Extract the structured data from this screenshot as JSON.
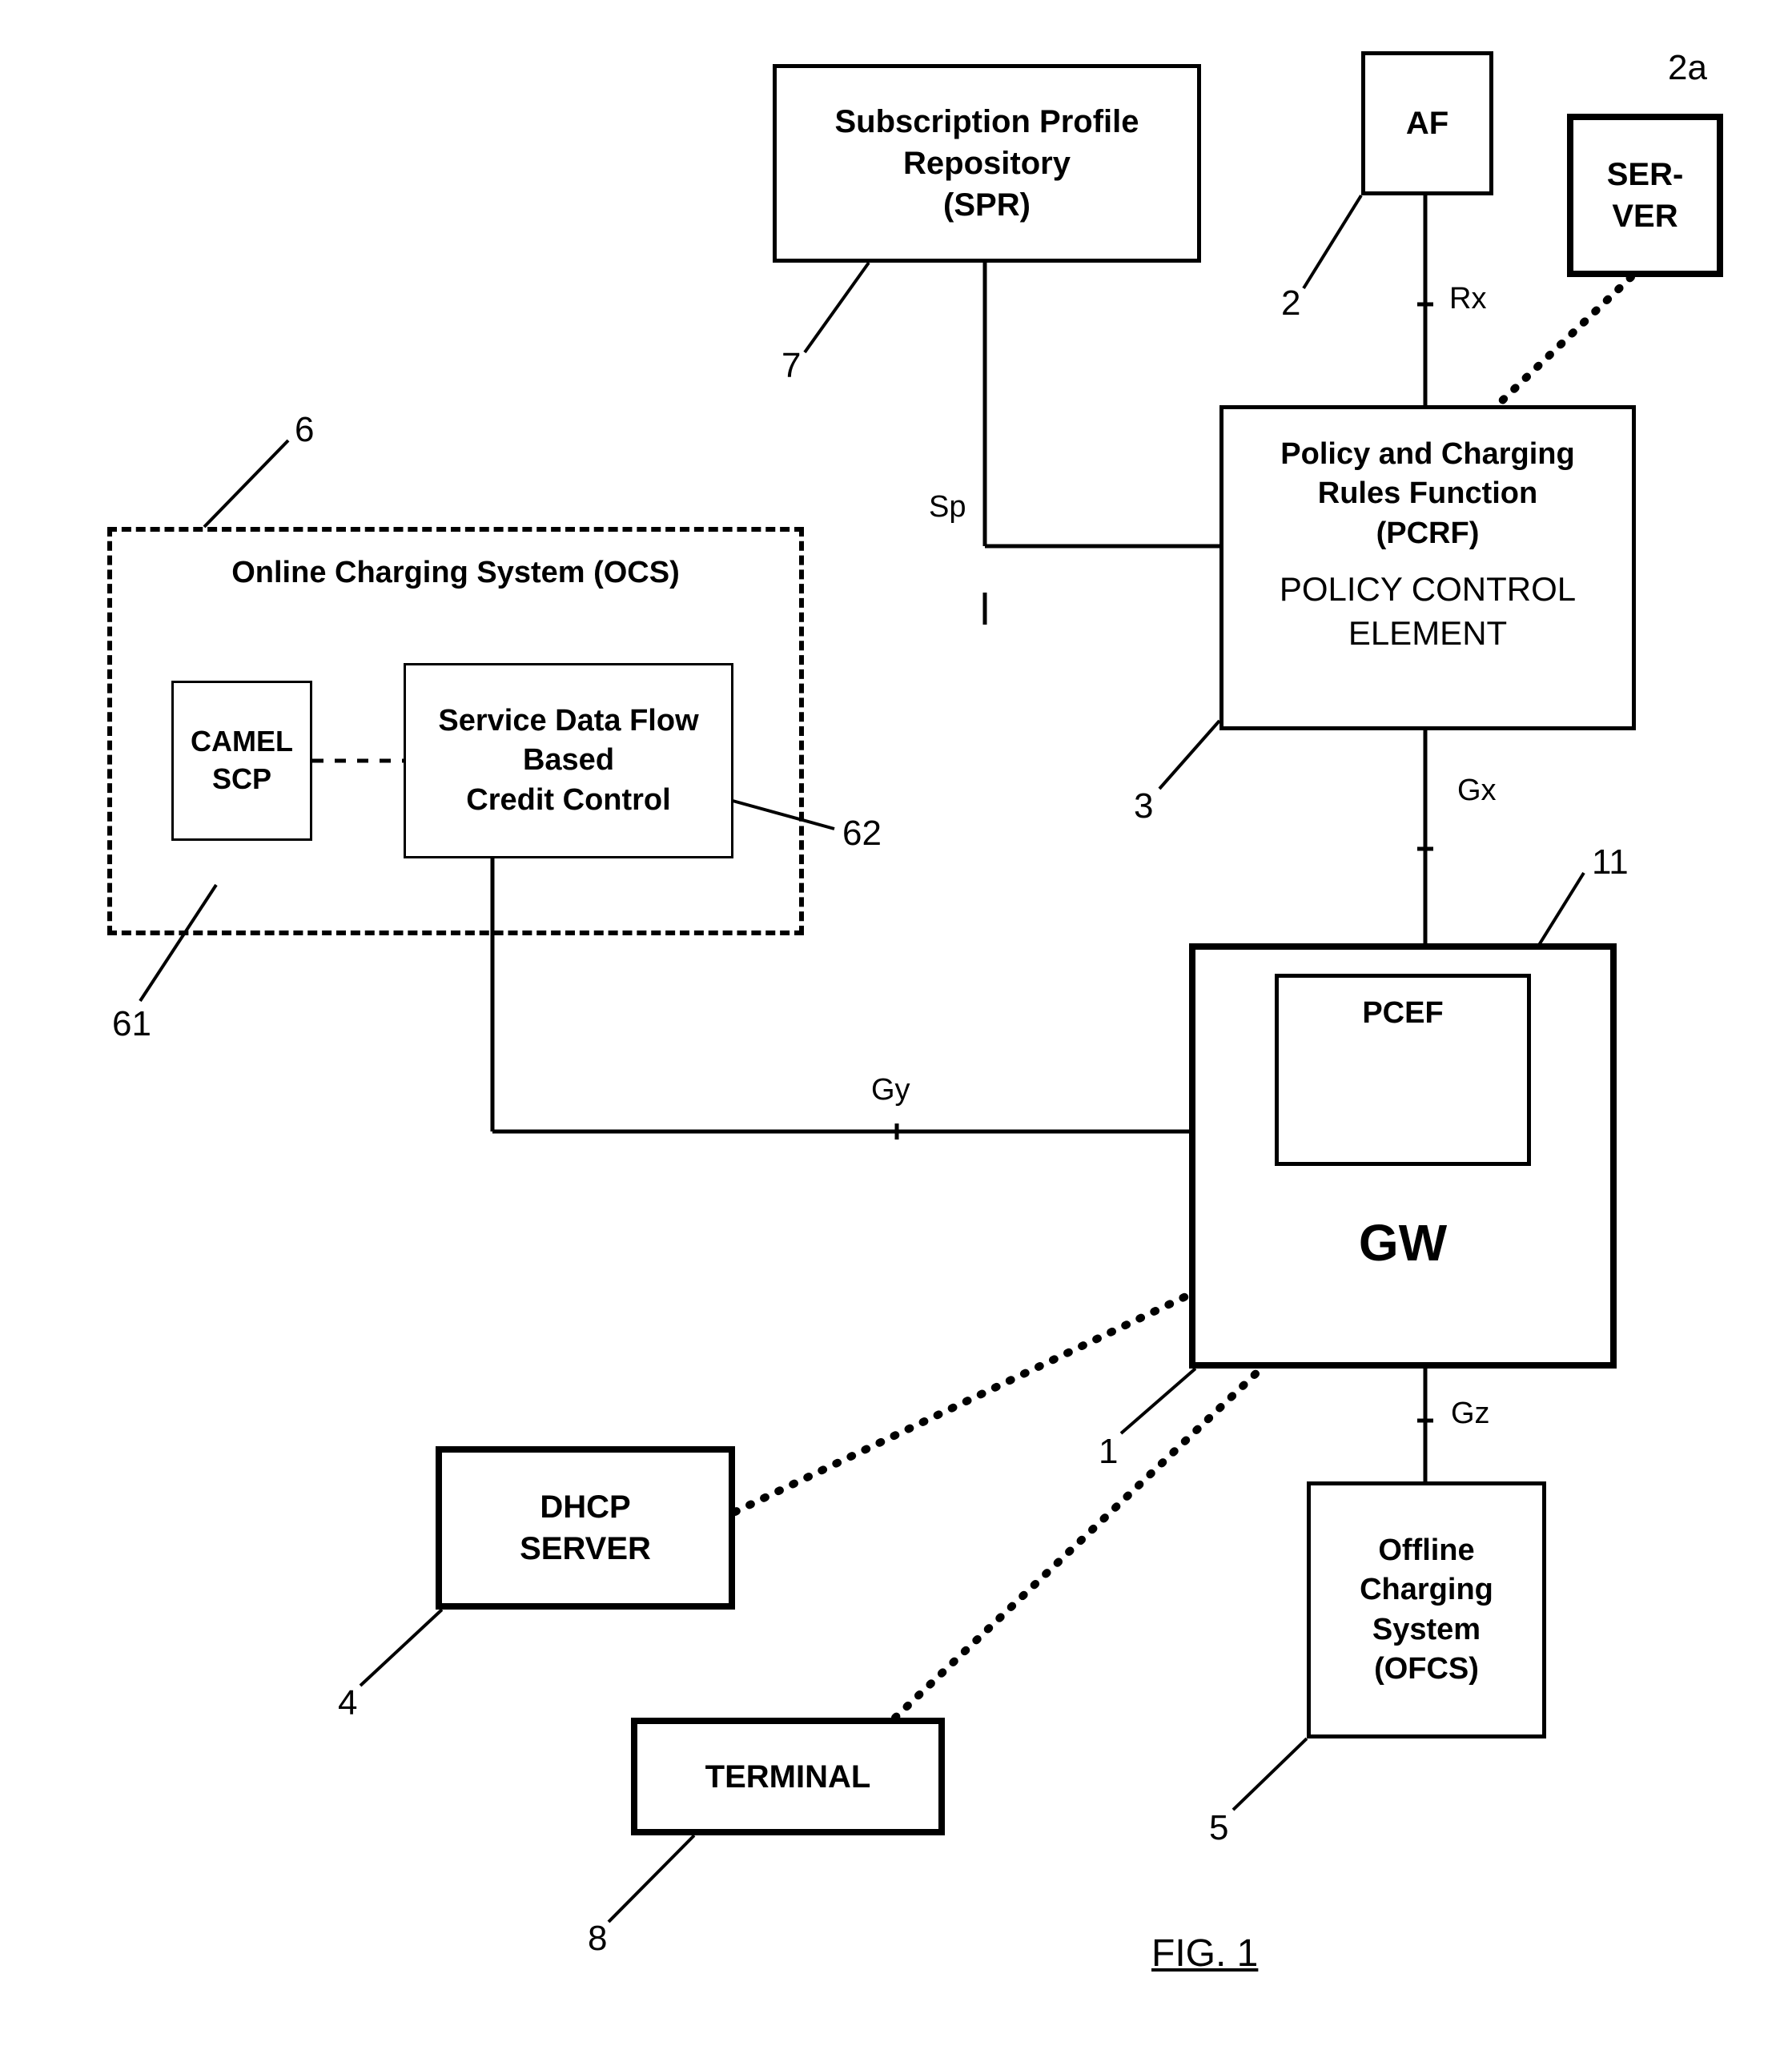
{
  "spr": {
    "line1": "Subscription Profile",
    "line2": "Repository",
    "line3": "(SPR)"
  },
  "af": {
    "label": "AF"
  },
  "server": {
    "line1": "SER-",
    "line2": "VER"
  },
  "pcrf": {
    "line1": "Policy and Charging",
    "line2": "Rules Function",
    "line3": "(PCRF)",
    "line4": "POLICY CONTROL",
    "line5": "ELEMENT"
  },
  "ocs": {
    "title": "Online Charging System (OCS)"
  },
  "camel": {
    "line1": "CAMEL",
    "line2": "SCP"
  },
  "sdf": {
    "line1": "Service Data Flow",
    "line2": "Based",
    "line3": "Credit Control"
  },
  "gw": {
    "pcef": "PCEF",
    "label": "GW"
  },
  "dhcp": {
    "line1": "DHCP",
    "line2": "SERVER"
  },
  "terminal": {
    "label": "TERMINAL"
  },
  "ofcs": {
    "line1": "Offline",
    "line2": "Charging",
    "line3": "System",
    "line4": "(OFCS)"
  },
  "interfaces": {
    "rx": "Rx",
    "sp": "Sp",
    "gx": "Gx",
    "gy": "Gy",
    "gz": "Gz"
  },
  "refs": {
    "r2a": "2a",
    "r2": "2",
    "r7": "7",
    "r6": "6",
    "r61": "61",
    "r62": "62",
    "r3": "3",
    "r11": "11",
    "r1": "1",
    "r4": "4",
    "r8": "8",
    "r5": "5"
  },
  "fig": "FIG. 1"
}
